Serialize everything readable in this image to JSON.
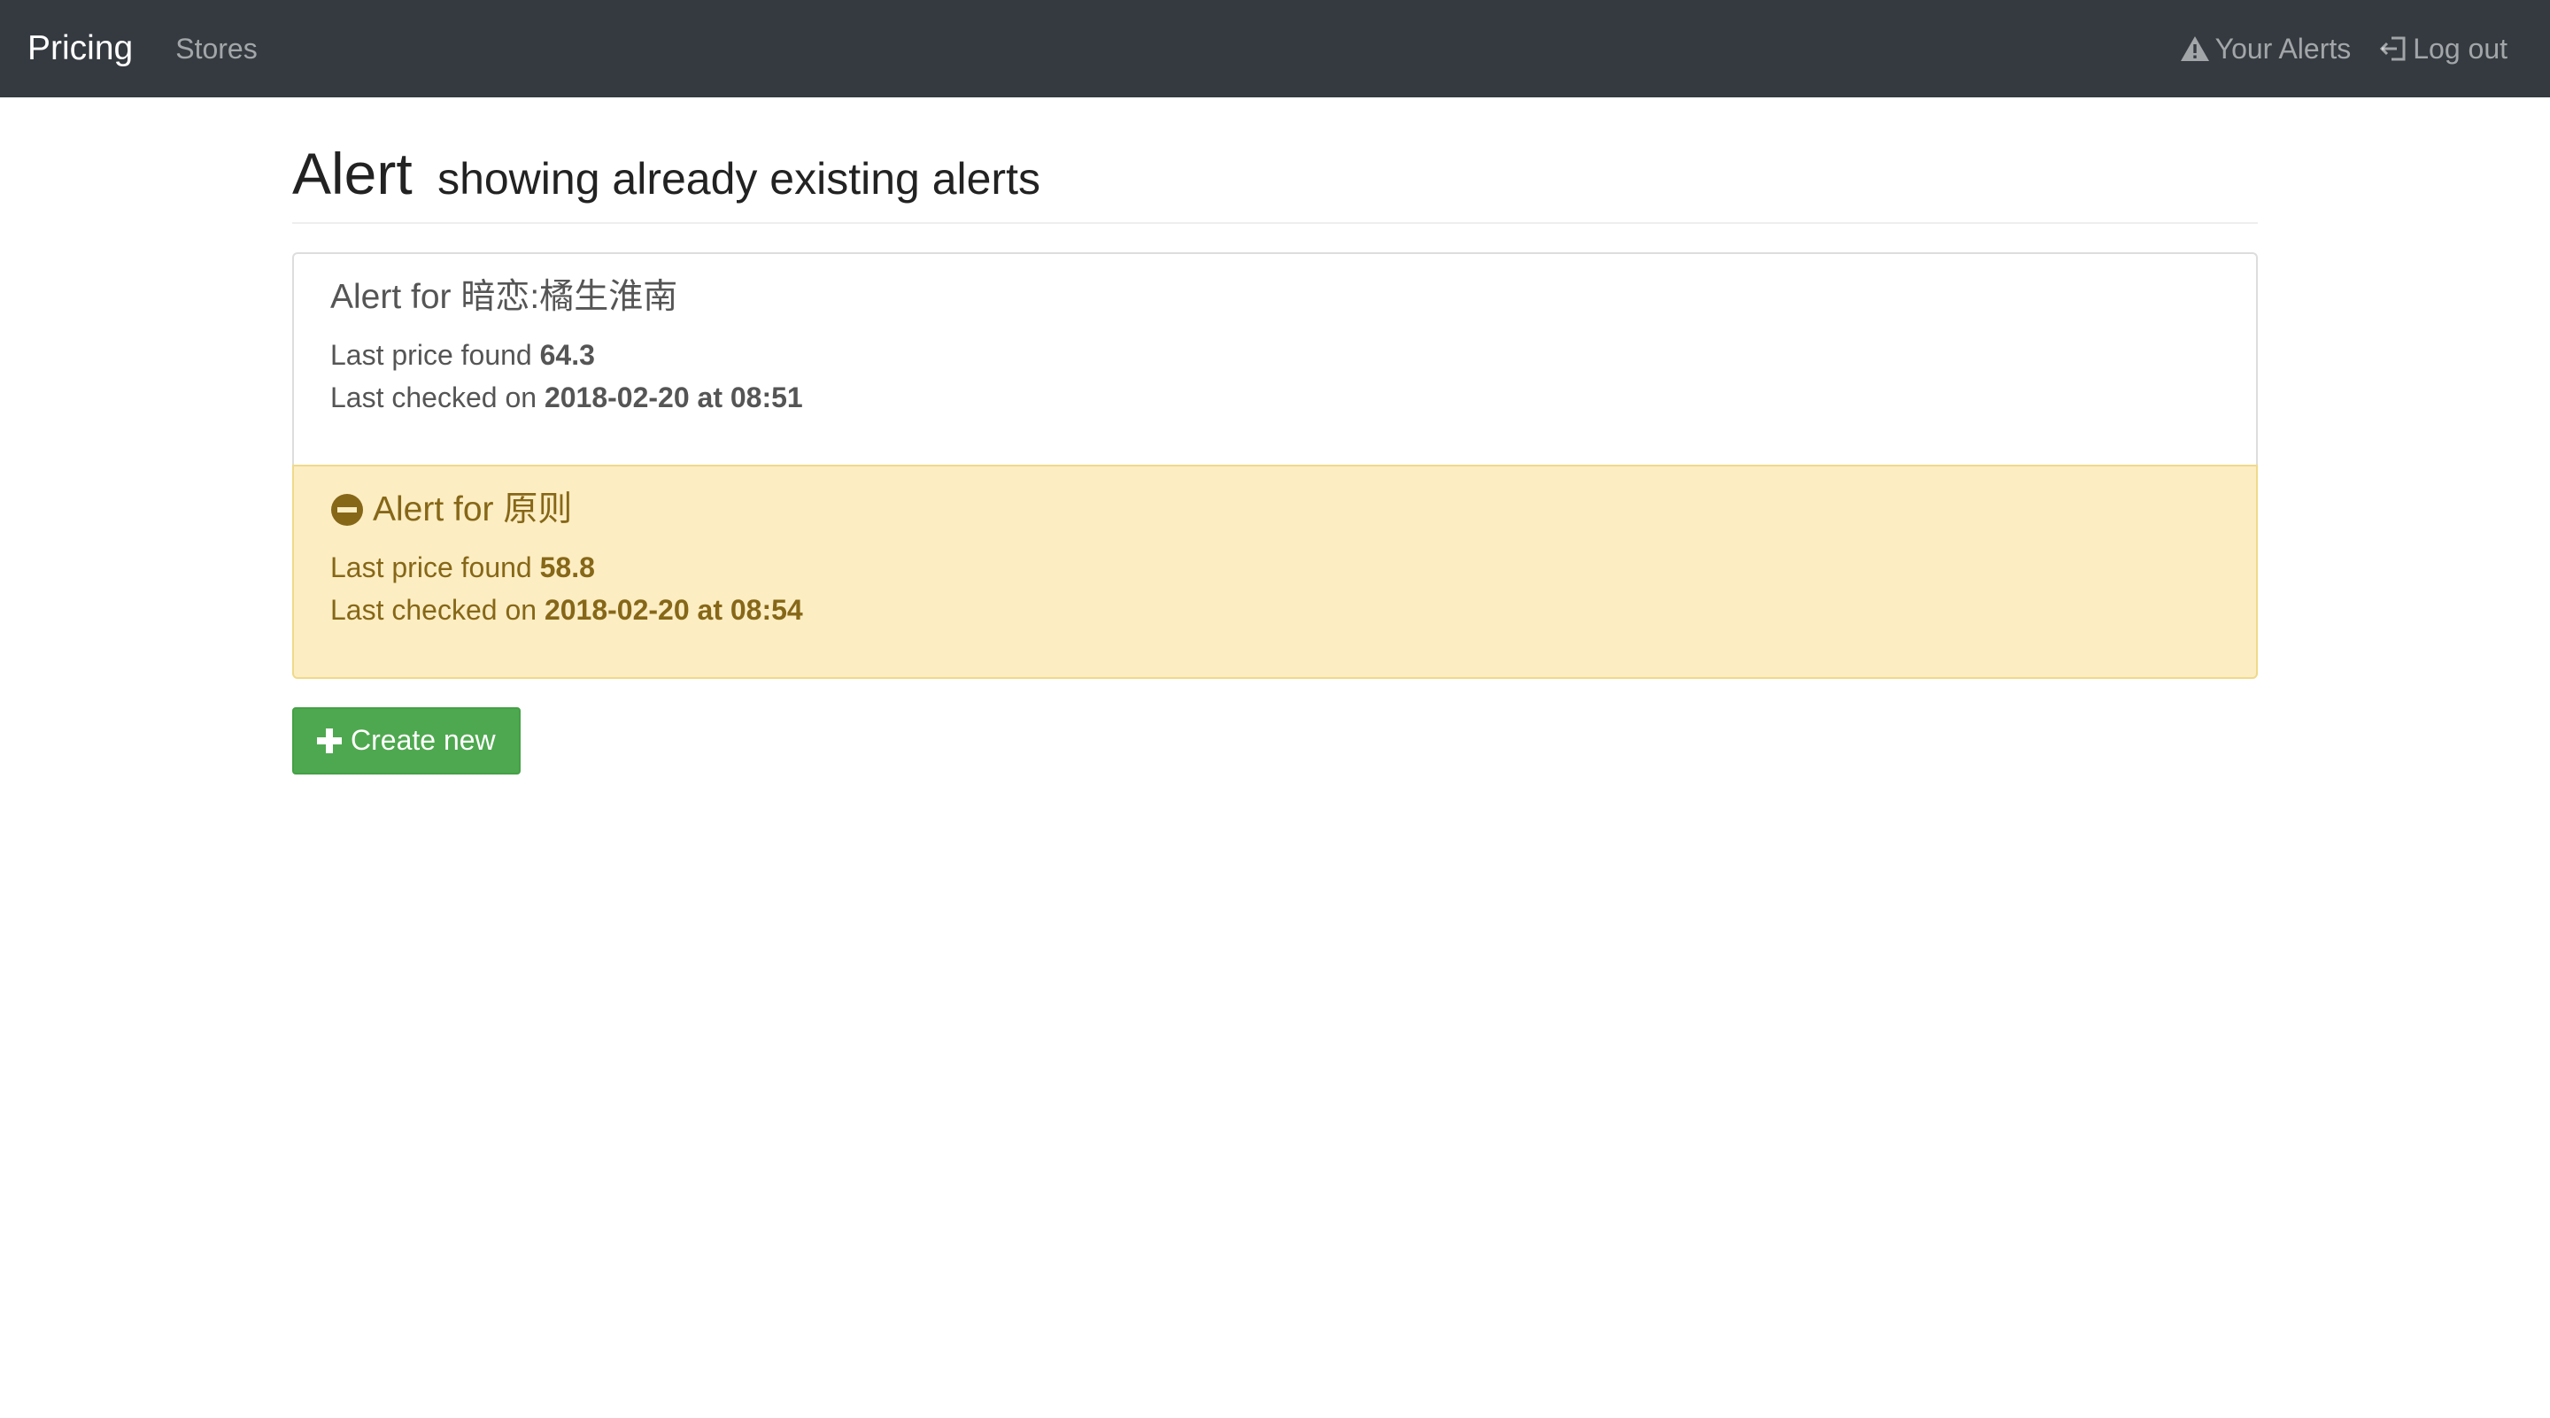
{
  "navbar": {
    "brand": "Pricing",
    "links": {
      "stores": "Stores",
      "your_alerts": "Your Alerts",
      "log_out": "Log out"
    }
  },
  "page": {
    "title": "Alert",
    "subtitle": "showing already existing alerts"
  },
  "alerts": [
    {
      "heading": "Alert for 暗恋:橘生淮南",
      "price_label": "Last price found",
      "price": "64.3",
      "checked_label": "Last checked on",
      "checked": "2018-02-20 at 08:51",
      "state": "active"
    },
    {
      "heading": "Alert for 原则",
      "price_label": "Last price found",
      "price": "58.8",
      "checked_label": "Last checked on",
      "checked": "2018-02-20 at 08:54",
      "state": "deactivated"
    }
  ],
  "actions": {
    "create_new": "Create new"
  },
  "colors": {
    "navbar_bg": "#343a40",
    "warning_bg": "#fcedc2",
    "warning_text": "#866718",
    "success_button": "#4ea84f"
  },
  "icons": {
    "your_alerts": "warning-triangle-icon",
    "log_out": "log-out-icon",
    "deactivated_alert": "minus-circle-icon",
    "create_new": "plus-icon"
  }
}
